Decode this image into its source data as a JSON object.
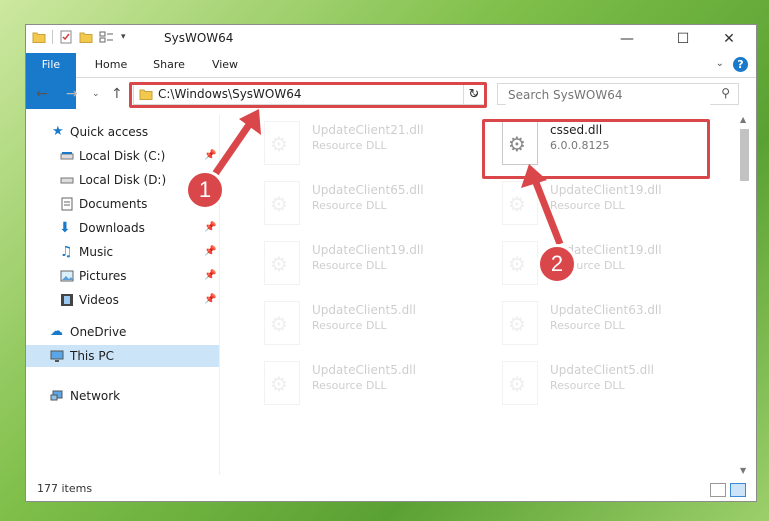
{
  "window": {
    "title": "SysWOW64"
  },
  "ribbon": {
    "tabs": [
      "File",
      "Home",
      "Share",
      "View"
    ],
    "help": "?"
  },
  "address": {
    "path": "C:\\Windows\\SysWOW64"
  },
  "search": {
    "placeholder": "Search SysWOW64"
  },
  "nav": {
    "quick_access": "Quick access",
    "items": [
      "Local Disk (C:)",
      "Local Disk (D:)",
      "Documents",
      "Downloads",
      "Music",
      "Pictures",
      "Videos"
    ],
    "onedrive": "OneDrive",
    "thispc": "This PC",
    "network": "Network"
  },
  "files": {
    "left": [
      {
        "name": "UpdateClient21.dll",
        "type": "Resource DLL"
      },
      {
        "name": "UpdateClient65.dll",
        "type": "Resource DLL"
      },
      {
        "name": "UpdateClient19.dll",
        "type": "Resource DLL"
      },
      {
        "name": "UpdateClient5.dll",
        "type": "Resource DLL"
      },
      {
        "name": "UpdateClient5.dll",
        "type": "Resource DLL"
      }
    ],
    "highlight": {
      "name": "cssed.dll",
      "version": "6.0.0.8125"
    },
    "right": [
      {
        "name": "UpdateClient19.dll",
        "type": "Resource DLL"
      },
      {
        "name": "UpdateClient19.dll",
        "type": "Resource DLL"
      },
      {
        "name": "UpdateClient63.dll",
        "type": "Resource DLL"
      },
      {
        "name": "UpdateClient5.dll",
        "type": "Resource DLL"
      }
    ]
  },
  "status": {
    "count": "177 items"
  },
  "callouts": {
    "one": "1",
    "two": "2"
  },
  "colors": {
    "accent": "#1979ca",
    "callout": "#d9474a",
    "selected": "#cce4f7"
  }
}
